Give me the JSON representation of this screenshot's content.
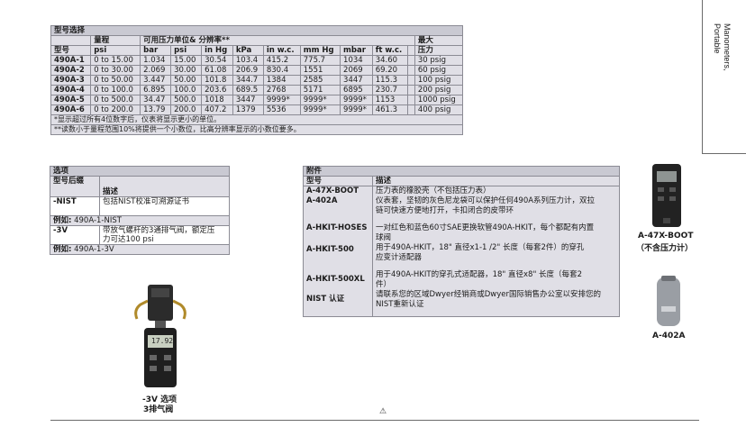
{
  "range_table": {
    "title": "型号选择",
    "head_model": "型号",
    "head_range": "量程",
    "head_units": "可用压力单位& 分辨率**",
    "head_max_1": "最大",
    "head_max_2": "压力",
    "units": [
      "psi",
      "bar",
      "psi",
      "in Hg",
      "kPa",
      "in w.c.",
      "mm Hg",
      "mbar",
      "ft w.c."
    ],
    "rows": [
      [
        "490A-1",
        "0 to 15.00",
        "1.034",
        "15.00",
        "30.54",
        "103.4",
        "415.2",
        "775.7",
        "1034",
        "34.60",
        "30 psig"
      ],
      [
        "490A-2",
        "0 to 30.00",
        "2.069",
        "30.00",
        "61.08",
        "206.9",
        "830.4",
        "1551",
        "2069",
        "69.20",
        "60 psig"
      ],
      [
        "490A-3",
        "0 to 50.00",
        "3.447",
        "50.00",
        "101.8",
        "344.7",
        "1384",
        "2585",
        "3447",
        "115.3",
        "100 psig"
      ],
      [
        "490A-4",
        "0 to 100.0",
        "6.895",
        "100.0",
        "203.6",
        "689.5",
        "2768",
        "5171",
        "6895",
        "230.7",
        "200 psig"
      ],
      [
        "490A-5",
        "0 to 500.0",
        "34.47",
        "500.0",
        "1018",
        "3447",
        "9999*",
        "9999*",
        "9999*",
        "1153",
        "1000 psig"
      ],
      [
        "490A-6",
        "0 to 200.0",
        "13.79",
        "200.0",
        "407.2",
        "1379",
        "5536",
        "9999*",
        "9999*",
        "461.3",
        "400 psig"
      ]
    ],
    "note_1": "*显示超过所有4位数字后，仪表将显示更小的单位。",
    "note_2": "**读数小于量程范围10%将提供一个小数位，比高分辨率显示的小数位要多。"
  },
  "side_tab": {
    "line1": "Manometers,",
    "line2": "Portable"
  },
  "options": {
    "title": "选项",
    "col_model": "型号后缀",
    "col_desc": "描述",
    "r1_code": "-NIST",
    "r1_desc": "包括NIST校准可溯源证书",
    "ex1_label": "例如:",
    "ex1_value": "490A-1-NIST",
    "r2_code": "-3V",
    "r2_desc_1": "带放气螺杆的3通排气阀，额定压",
    "r2_desc_2": "力可达100 psi",
    "ex2_label": "例如:",
    "ex2_value": "490A-1-3V"
  },
  "accessories": {
    "title": "附件",
    "col_model": "型号",
    "col_desc": "描述",
    "rows": [
      {
        "code": "A-47X-BOOT",
        "desc": [
          "压力表的橡胶壳（不包括压力表）"
        ]
      },
      {
        "code": "A-402A",
        "desc": [
          "仪表套，坚韧的灰色尼龙袋可以保护任何490A系列压力计，双拉",
          "链可快速方便地打开，卡扣闭合的皮带环"
        ]
      },
      {
        "code": "A-HKIT-HOSES",
        "desc": [
          "一对红色和蓝色60寸SAE更换软管490A-HKIT，每个都配有内置",
          "球阀"
        ]
      },
      {
        "code": "A-HKIT-500",
        "desc": [
          "用于490A-HKIT，18\"  直径x1-1 /2\"    长度（每套2件）的穿孔",
          "应变计适配器"
        ]
      },
      {
        "code": "A-HKIT-500XL",
        "desc": [
          "用于490A-HKIT的穿孔式适配器，18\"  直径x8\"    长度（每套2",
          "件）"
        ]
      },
      {
        "code": "NIST 认证",
        "desc": [
          "请联系您的区域Dwyer经销商或Dwyer国际销售办公室以安排您的",
          "NIST重新认证"
        ]
      }
    ]
  },
  "captions": {
    "valve_1": "-3V 选项",
    "valve_2": "3排气阀",
    "boot_1": "A-47X-BOOT",
    "boot_2": "（不含压力计）",
    "case": "A-402A"
  },
  "device_display": "17.92"
}
